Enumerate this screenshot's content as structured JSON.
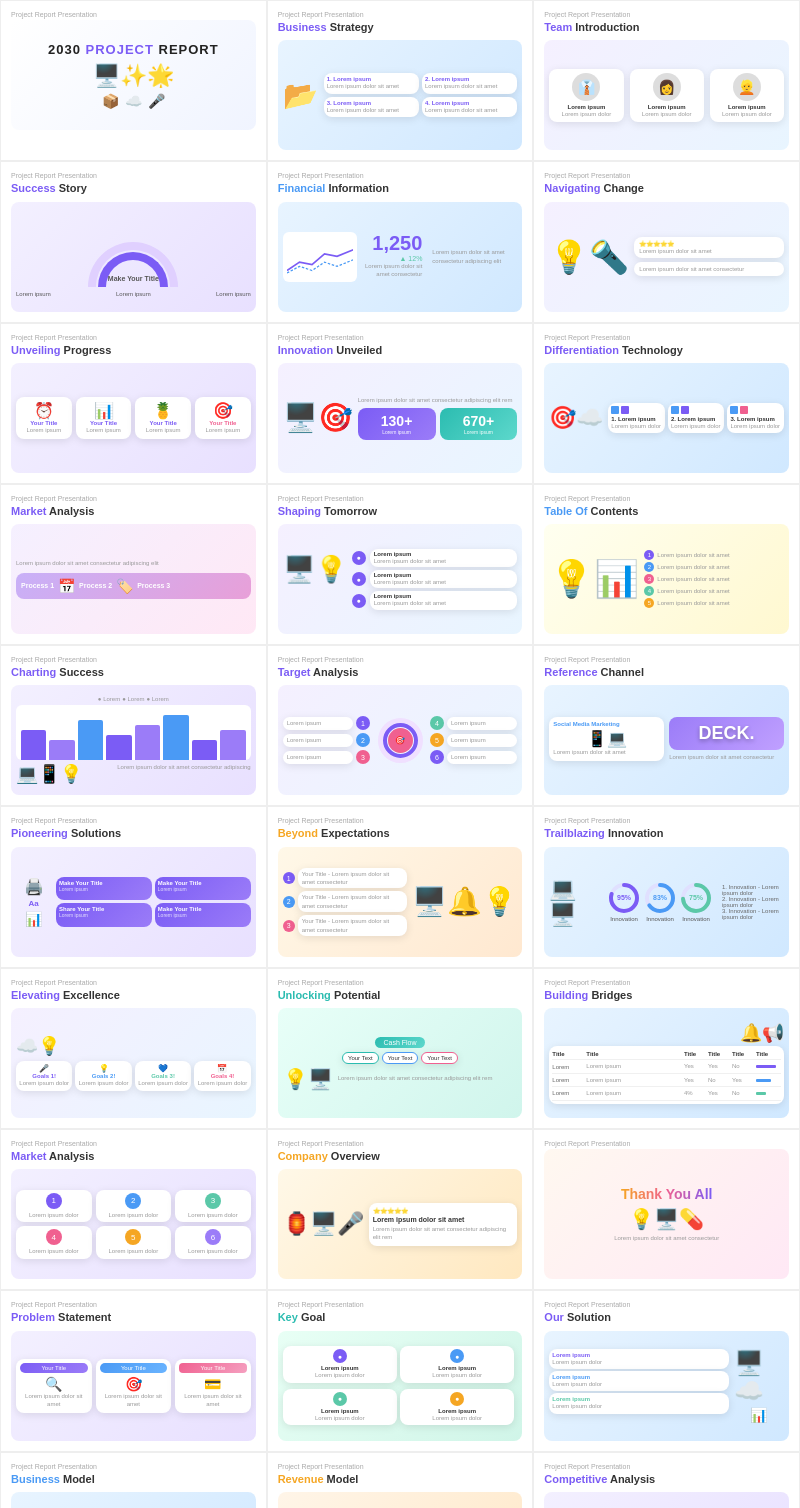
{
  "slides": [
    {
      "id": "cover",
      "label": "Project Report Presentation",
      "title": "2030 PROJECT REPORT",
      "title_accent": "PROJECT",
      "accent_color": "#7b5cf5",
      "type": "cover"
    },
    {
      "id": "business-strategy",
      "label": "Project Report Presentation",
      "title_prefix": "Business",
      "title_suffix": " Strategy",
      "accent_color": "#7b5cf5",
      "type": "flow"
    },
    {
      "id": "team-intro",
      "label": "Project Report Presentation",
      "title_prefix": "Team",
      "title_suffix": " Introduction",
      "accent_color": "#7b5cf5",
      "type": "team"
    },
    {
      "id": "success-story",
      "label": "Project Report Presentation",
      "title_prefix": "Success",
      "title_suffix": " Story",
      "accent_color": "#7b5cf5",
      "type": "semicircle"
    },
    {
      "id": "financial-info",
      "label": "Project Report Presentation",
      "title_prefix": "Financial",
      "title_suffix": " Information",
      "accent_color": "#4a9af5",
      "type": "stats"
    },
    {
      "id": "navigating-change",
      "label": "Project Report Presentation",
      "title_prefix": "Navigating",
      "title_suffix": " Change",
      "accent_color": "#7b5cf5",
      "type": "info"
    },
    {
      "id": "unveiling-progress",
      "label": "Project Report Presentation",
      "title_prefix": "Unveiling",
      "title_suffix": " Progress",
      "accent_color": "#7b5cf5",
      "type": "cards4"
    },
    {
      "id": "innovation-unveiled",
      "label": "Project Report Presentation",
      "title_prefix": "Innovation",
      "title_suffix": " Unveiled",
      "accent_color": "#7b5cf5",
      "type": "stats2"
    },
    {
      "id": "differentiation-tech",
      "label": "Project Report Presentation",
      "title_prefix": "Differentiation",
      "title_suffix": " Technology",
      "accent_color": "#7b5cf5",
      "type": "compare3"
    },
    {
      "id": "market-analysis-1",
      "label": "Project Report Presentation",
      "title_prefix": "Market",
      "title_suffix": " Analysis",
      "accent_color": "#7b5cf5",
      "type": "market1"
    },
    {
      "id": "shaping-tomorrow",
      "label": "Project Report Presentation",
      "title_prefix": "Shaping",
      "title_suffix": " Tomorrow",
      "accent_color": "#7b5cf5",
      "type": "steps3"
    },
    {
      "id": "table-of-contents",
      "label": "Project Report Presentation",
      "title_prefix": "Table Of",
      "title_suffix": " Contents",
      "accent_color": "#4a9af5",
      "type": "toc"
    },
    {
      "id": "charting-success",
      "label": "Project Report Presentation",
      "title_prefix": "Charting",
      "title_suffix": " Success",
      "accent_color": "#7b5cf5",
      "type": "barchart"
    },
    {
      "id": "target-analysis",
      "label": "Project Report Presentation",
      "title_prefix": "Target",
      "title_suffix": " Analysis",
      "accent_color": "#7b5cf5",
      "type": "target"
    },
    {
      "id": "reference-channel",
      "label": "Project Report Presentation",
      "title_prefix": "Reference",
      "title_suffix": " Channel",
      "accent_color": "#7b5cf5",
      "type": "reference"
    },
    {
      "id": "pioneering-solutions",
      "label": "Project Report Presentation",
      "title_prefix": "Pioneering",
      "title_suffix": " Solutions",
      "accent_color": "#7b5cf5",
      "type": "pioneer"
    },
    {
      "id": "beyond-expectations",
      "label": "Project Report Presentation",
      "title_prefix": "Beyond",
      "title_suffix": " Expectations",
      "accent_color": "#f5a623",
      "type": "beyond"
    },
    {
      "id": "trailblazing-innovation",
      "label": "Project Report Presentation",
      "title_prefix": "Trailblazing",
      "title_suffix": " Innovation",
      "accent_color": "#7b5cf5",
      "type": "donut3"
    },
    {
      "id": "elevating-excellence",
      "label": "Project Report Presentation",
      "title_prefix": "Elevating",
      "title_suffix": " Excellence",
      "accent_color": "#7b5cf5",
      "type": "goals4"
    },
    {
      "id": "unlocking-potential",
      "label": "Project Report Presentation",
      "title_prefix": "Unlocking",
      "title_suffix": " Potential",
      "accent_color": "#2bbcb0",
      "type": "flowchart"
    },
    {
      "id": "building-bridges",
      "label": "Project Report Presentation",
      "title_prefix": "Building",
      "title_suffix": " Bridges",
      "accent_color": "#7b5cf5",
      "type": "table"
    },
    {
      "id": "market-analysis-2",
      "label": "Project Report Presentation",
      "title_prefix": "Market",
      "title_suffix": " Analysis",
      "accent_color": "#7b5cf5",
      "type": "circles3"
    },
    {
      "id": "company-overview",
      "label": "Project Report Presentation",
      "title_prefix": "Company",
      "title_suffix": " Overview",
      "accent_color": "#f5a623",
      "type": "company"
    },
    {
      "id": "thank-you",
      "label": "Project Report Presentation",
      "title": "Thank You All",
      "accent_color": "#f06090",
      "type": "thankyou"
    },
    {
      "id": "problem-statement",
      "label": "Project Report Presentation",
      "title_prefix": "Problem",
      "title_suffix": " Statement",
      "accent_color": "#7b5cf5",
      "type": "cards3b"
    },
    {
      "id": "key-goal",
      "label": "Project Report Presentation",
      "title_prefix": "Key",
      "title_suffix": " Goal",
      "accent_color": "#2bbcb0",
      "type": "steps4"
    },
    {
      "id": "our-solution",
      "label": "Project Report Presentation",
      "title_prefix": "Our",
      "title_suffix": " Solution",
      "accent_color": "#7b5cf5",
      "type": "solution"
    },
    {
      "id": "business-model",
      "label": "Project Report Presentation",
      "title_prefix": "Business",
      "title_suffix": " Model",
      "accent_color": "#4a9af5",
      "type": "rocket"
    },
    {
      "id": "revenue-model",
      "label": "Project Report Presentation",
      "title_prefix": "Revenue",
      "title_suffix": " Model",
      "accent_color": "#f5a623",
      "type": "revenue"
    },
    {
      "id": "competitive-analysis",
      "label": "Project Report Presentation",
      "title_prefix": "Competitive",
      "title_suffix": " Analysis",
      "accent_color": "#7b5cf5",
      "type": "competitive"
    }
  ]
}
